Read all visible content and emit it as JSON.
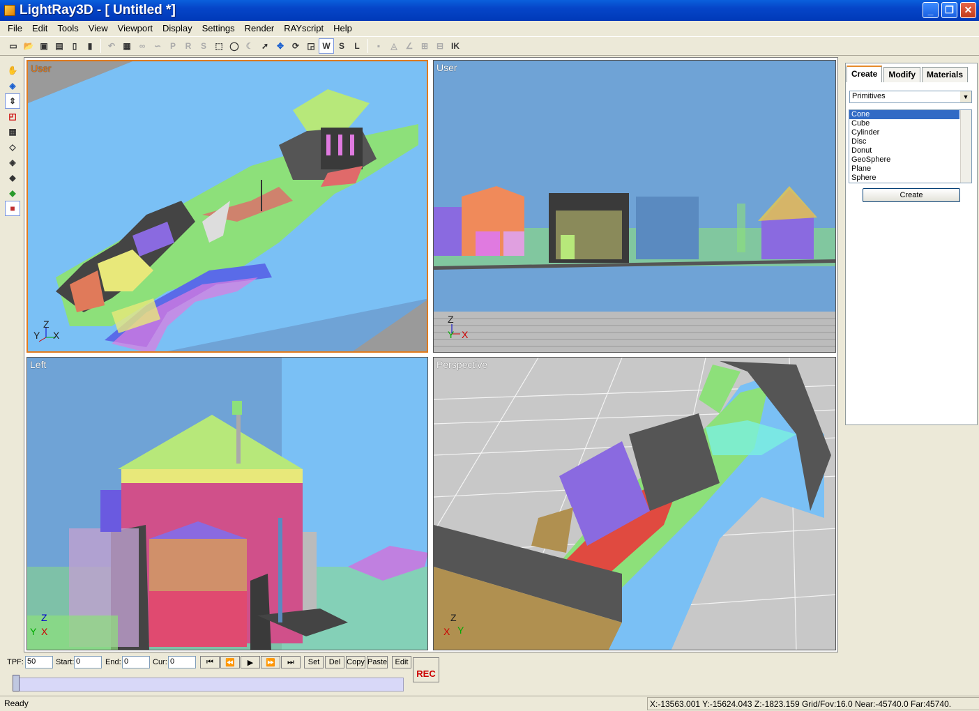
{
  "window": {
    "title": "LightRay3D - [ Untitled *]",
    "min": "_",
    "max": "❐",
    "close": "✕"
  },
  "menu": [
    "File",
    "Edit",
    "Tools",
    "View",
    "Viewport",
    "Display",
    "Settings",
    "Render",
    "RAYscript",
    "Help"
  ],
  "toolbar": {
    "p": "P",
    "r": "R",
    "s": "S",
    "w": "W",
    "s2": "S",
    "l": "L",
    "ik": "IK"
  },
  "viewports": {
    "top_left": "User",
    "top_right": "User",
    "bottom_left": "Left",
    "bottom_right": "Perspective"
  },
  "axes": {
    "x": "X",
    "y": "Y",
    "z": "Z"
  },
  "panel": {
    "tabs": [
      "Create",
      "Modify",
      "Materials"
    ],
    "combo": "Primitives",
    "primitives": [
      "Cone",
      "Cube",
      "Cylinder",
      "Disc",
      "Donut",
      "GeoSphere",
      "Plane",
      "Sphere"
    ],
    "selected": "Cone",
    "create_label": "Create"
  },
  "animation": {
    "tpf_label": "TPF:",
    "tpf": "50",
    "start_label": "Start:",
    "start": "0",
    "end_label": "End:",
    "end": "0",
    "cur_label": "Cur:",
    "cur": "0",
    "set": "Set",
    "del": "Del",
    "copy": "Copy",
    "paste": "Paste",
    "edit": "Edit",
    "rec": "REC"
  },
  "status": {
    "text": "Ready",
    "coords": "X:-13563.001 Y:-15624.043 Z:-1823.159  Grid/Fov:16.0 Near:-45740.0 Far:45740."
  },
  "colors": {
    "title": "#0545c8",
    "viewport_sky": "#7ac0f5",
    "ground": "#8de07a",
    "house_roof": "#b7e87a",
    "active_border": "#e07b1e"
  }
}
